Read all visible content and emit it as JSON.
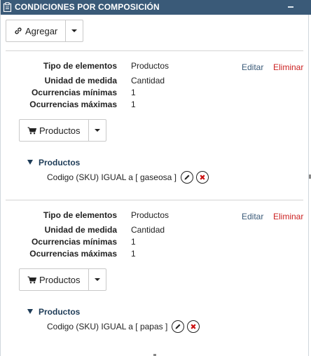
{
  "header": {
    "title": "CONDICIONES POR COMPOSICIÓN"
  },
  "toolbar": {
    "add_label": "Agregar"
  },
  "conditions": [
    {
      "fields": [
        {
          "label": "Tipo de elementos",
          "value": "Productos"
        },
        {
          "label": "Unidad de medida",
          "value": "Cantidad"
        },
        {
          "label": "Ocurrencias mínimas",
          "value": "1"
        },
        {
          "label": "Ocurrencias máximas",
          "value": "1"
        }
      ],
      "edit_label": "Editar",
      "delete_label": "Eliminar",
      "products_button_label": "Productos",
      "tree": {
        "heading": "Productos",
        "rule": "Codigo (SKU) IGUAL a [ gaseosa ]"
      }
    },
    {
      "fields": [
        {
          "label": "Tipo de elementos",
          "value": "Productos"
        },
        {
          "label": "Unidad de medida",
          "value": "Cantidad"
        },
        {
          "label": "Ocurrencias mínimas",
          "value": "1"
        },
        {
          "label": "Ocurrencias máximas",
          "value": "1"
        }
      ],
      "edit_label": "Editar",
      "delete_label": "Eliminar",
      "products_button_label": "Productos",
      "tree": {
        "heading": "Productos",
        "rule": "Codigo (SKU) IGUAL a [ papas ]"
      }
    }
  ],
  "colors": {
    "header_bg": "#3a5a78",
    "delete_link": "#cc2222",
    "edit_link": "#3a5a78"
  }
}
